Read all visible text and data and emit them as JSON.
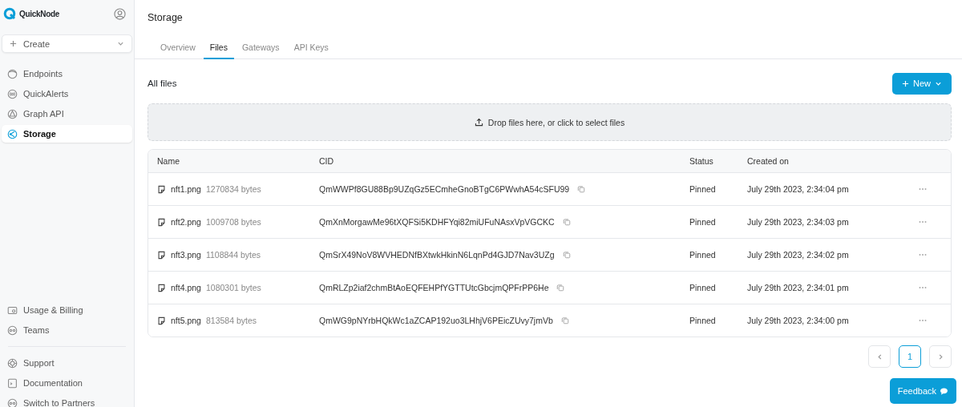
{
  "brand": {
    "name": "QuickNode"
  },
  "create_button": {
    "label": "Create"
  },
  "sidebar": {
    "items": [
      {
        "label": "Endpoints",
        "kind": "endpoints",
        "selected": false
      },
      {
        "label": "QuickAlerts",
        "kind": "alerts",
        "selected": false
      },
      {
        "label": "Graph API",
        "kind": "graph",
        "selected": false
      },
      {
        "label": "Storage",
        "kind": "storage",
        "selected": true
      }
    ],
    "bottom_items": [
      {
        "label": "Usage & Billing",
        "kind": "billing"
      },
      {
        "label": "Teams",
        "kind": "teams"
      }
    ],
    "footer_items": [
      {
        "label": "Support",
        "kind": "support"
      },
      {
        "label": "Documentation",
        "kind": "docs"
      },
      {
        "label": "Switch to Partners",
        "kind": "teams"
      }
    ]
  },
  "page": {
    "title": "Storage"
  },
  "tabs": [
    {
      "label": "Overview",
      "selected": false
    },
    {
      "label": "Files",
      "selected": true
    },
    {
      "label": "Gateways",
      "selected": false
    },
    {
      "label": "API Keys",
      "selected": false
    }
  ],
  "section": {
    "title": "All files",
    "new_button": "New"
  },
  "dropzone": {
    "text": "Drop files here, or click to select files"
  },
  "table": {
    "columns": [
      "Name",
      "CID",
      "Status",
      "Created on"
    ],
    "rows": [
      {
        "name": "nft1.png",
        "size": "1270834 bytes",
        "cid": "QmWWPf8GU88Bp9UZqGz5ECmheGnoBTgC6PWwhA54cSFU99",
        "status": "Pinned",
        "created": "July 29th 2023, 2:34:04 pm"
      },
      {
        "name": "nft2.png",
        "size": "1009708 bytes",
        "cid": "QmXnMorgawMe96tXQFSi5KDHFYqi82miUFuNAsxVpVGCKC",
        "status": "Pinned",
        "created": "July 29th 2023, 2:34:03 pm"
      },
      {
        "name": "nft3.png",
        "size": "1108844 bytes",
        "cid": "QmSrX49NoV8WVHEDNfBXtwkHkinN6LqnPd4GJD7Nav3UZg",
        "status": "Pinned",
        "created": "July 29th 2023, 2:34:02 pm"
      },
      {
        "name": "nft4.png",
        "size": "1080301 bytes",
        "cid": "QmRLZp2iaf2chmBtAoEQFEHPfYGTTUtcGbcjmQPFrPP6He",
        "status": "Pinned",
        "created": "July 29th 2023, 2:34:01 pm"
      },
      {
        "name": "nft5.png",
        "size": "813584 bytes",
        "cid": "QmWG9pNYrbHQkWc1aZCAP192uo3LHhjV6PEicZUvy7jmVb",
        "status": "Pinned",
        "created": "July 29th 2023, 2:34:00 pm"
      }
    ]
  },
  "pagination": {
    "pages": [
      {
        "label": "1",
        "selected": true
      }
    ]
  },
  "feedback_button": {
    "label": "Feedback"
  }
}
